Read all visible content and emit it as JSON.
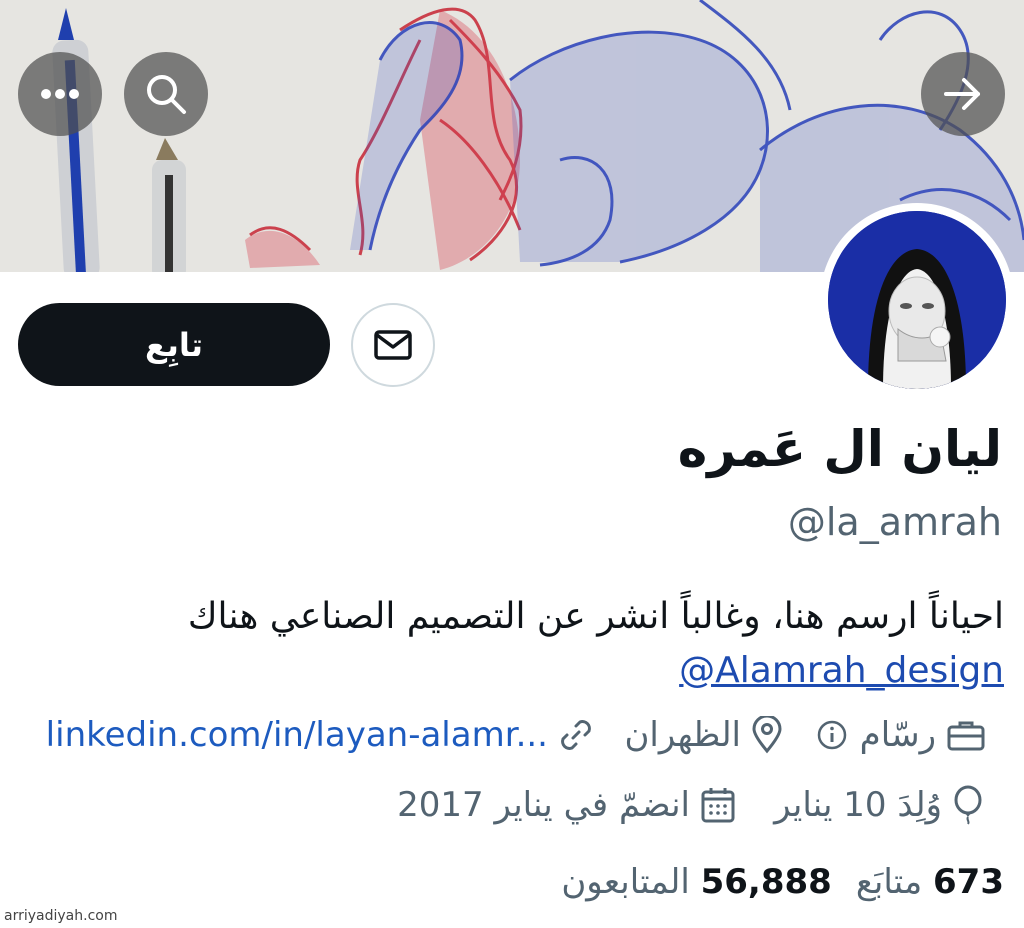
{
  "header": {
    "more_icon": "more-horizontal-icon",
    "search_icon": "search-icon",
    "forward_icon": "arrow-right-icon"
  },
  "profile": {
    "name": "ليان ال عَمره",
    "handle": "@la_amrah",
    "bio_text": "احياناً ارسم هنا، وغالباً انشر عن التصميم الصناعي هناك",
    "bio_link": "@Alamrah_design",
    "follow_label": "تابِع"
  },
  "meta": {
    "job": "رسّام",
    "location": "الظهران",
    "website": "linkedin.com/in/layan-alamr...",
    "birthday": "وُلِدَ 10 يناير",
    "joined": "انضمّ في يناير 2017"
  },
  "stats": {
    "following_count": "673",
    "following_label": "متابَع",
    "followers_count": "56,888",
    "followers_label": "المتابعون"
  },
  "watermark": "arriyadiyah.com",
  "colors": {
    "accent": "#1d5bbf",
    "text": "#0f1419",
    "muted": "#536471",
    "button_dark": "#0f1419"
  }
}
